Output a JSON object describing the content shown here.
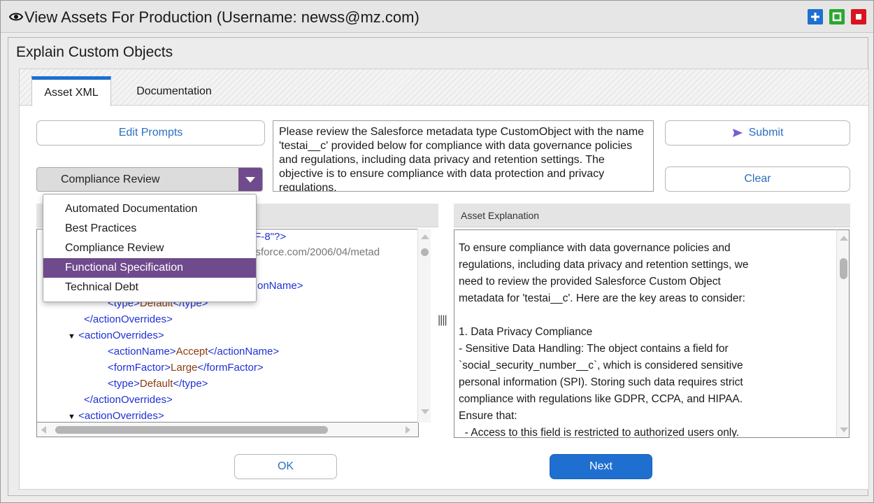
{
  "window": {
    "title": "View Assets For Production (Username: newss@mz.com)"
  },
  "dialog": {
    "title": "Explain Custom Objects"
  },
  "tabs": [
    {
      "label": "Asset XML",
      "active": true
    },
    {
      "label": "Documentation",
      "active": false
    }
  ],
  "buttons": {
    "edit_prompts": "Edit Prompts",
    "submit": "Submit",
    "clear": "Clear",
    "ok": "OK",
    "next": "Next"
  },
  "prompt_text": "Please review the Salesforce metadata type CustomObject with the name 'testai__c' provided below for compliance with data governance policies and regulations, including data privacy and retention settings. The objective is to ensure compliance with data protection and privacy regulations.",
  "prompt_type": {
    "selected": "Compliance Review",
    "options": [
      "Automated Documentation",
      "Best Practices",
      "Compliance Review",
      "Functional Specification",
      "Technical Debt"
    ],
    "highlighted": "Functional Specification"
  },
  "xml_panel": {
    "fragments": {
      "encoding_tail": "TF-8\"?>",
      "namespace_tail": "p.sforce.com/2006/04/metad",
      "action_name_tail": "ctionName>"
    },
    "lines": [
      {
        "kind": "leaf",
        "open": "<type>",
        "value": "Default",
        "close": "</type>"
      },
      {
        "kind": "close",
        "text": "</actionOverrides>"
      },
      {
        "kind": "open",
        "text": "<actionOverrides>"
      },
      {
        "kind": "leaf",
        "open": "<actionName>",
        "value": "Accept",
        "close": "</actionName>"
      },
      {
        "kind": "leaf",
        "open": "<formFactor>",
        "value": "Large",
        "close": "</formFactor>"
      },
      {
        "kind": "leaf",
        "open": "<type>",
        "value": "Default",
        "close": "</type>"
      },
      {
        "kind": "close",
        "text": "</actionOverrides>"
      },
      {
        "kind": "open",
        "text": "<actionOverrides>"
      }
    ]
  },
  "explanation_panel": {
    "header": "Asset Explanation",
    "lines": [
      "To ensure compliance with data governance policies and",
      "regulations, including data privacy and retention settings, we",
      "need to review the provided Salesforce Custom Object",
      "metadata for 'testai__c'. Here are the key areas to consider:",
      "",
      "1. Data Privacy Compliance",
      "- Sensitive Data Handling: The object contains a field for",
      "`social_security_number__c`, which is considered sensitive",
      "personal information (SPI). Storing such data requires strict",
      "compliance with regulations like GDPR, CCPA, and HIPAA.",
      "Ensure that:",
      "  - Access to this field is restricted to authorized users only."
    ]
  },
  "colors": {
    "accent_blue": "#1e6fd0",
    "purple": "#6f4a8c",
    "tag_blue": "#1d31d6",
    "value_brown": "#8a3a10"
  },
  "icons": [
    "eye-icon",
    "plus-icon",
    "maximize-icon",
    "close-icon",
    "send-icon",
    "chevron-down-icon",
    "collapse-triangle-icon",
    "splitter-grip-icon"
  ]
}
